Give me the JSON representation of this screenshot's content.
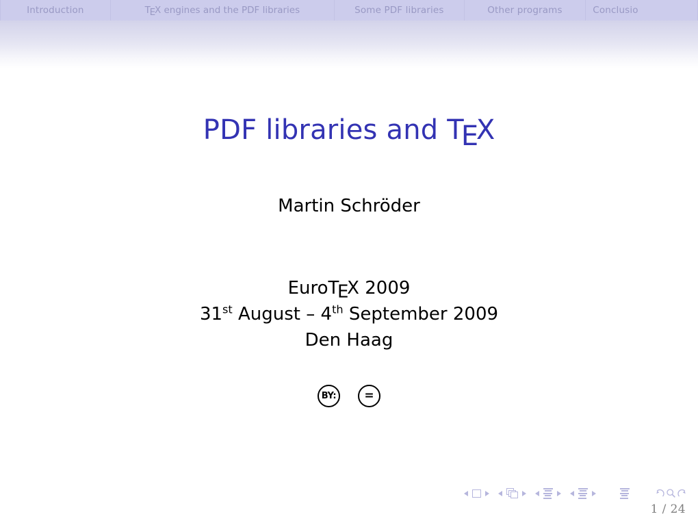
{
  "navbar": {
    "sections": [
      {
        "label": "Introduction",
        "id": "introduction"
      },
      {
        "label": "TEX engines and the PDF libraries",
        "id": "tex-engines-and-the-pdf-libraries",
        "prefix": "T",
        "mid": "E",
        "suffix": "X engines and the PDF libraries"
      },
      {
        "label": "Some PDF libraries",
        "id": "some-pdf-libraries"
      },
      {
        "label": "Other programs",
        "id": "other-programs"
      },
      {
        "label": "Conclusio",
        "id": "conclusion"
      }
    ],
    "background_color": "#ccccec",
    "text_color": "#9999c4"
  },
  "title": {
    "prefix": "PDF libraries and ",
    "tex_t": "T",
    "tex_e": "E",
    "tex_x": "X",
    "full_text": "PDF libraries and TEX",
    "color": "#3333b3"
  },
  "author": {
    "name": "Martin Schröder"
  },
  "event": {
    "conference_prefix": "Euro",
    "conference_tex_t": "T",
    "conference_tex_e": "E",
    "conference_tex_x": "X",
    "conference_year": " 2009",
    "conference_full": "EuroTEX 2009",
    "date_day_start": "31",
    "date_ord_start": "st",
    "date_month_start": " August ",
    "date_dash": "– ",
    "date_day_end": "4",
    "date_ord_end": "th",
    "date_month_end": " September 2009",
    "date_full": "31st August – 4th September 2009",
    "location": "Den Haag"
  },
  "license": {
    "badges": [
      {
        "id": "cc-by",
        "label": "BY:",
        "title": "Creative Commons Attribution"
      },
      {
        "id": "cc-nd",
        "label": "=",
        "title": "Creative Commons No Derivatives"
      }
    ]
  },
  "beamer_nav": {
    "icon_color": "#b6b6dd",
    "groups": [
      {
        "id": "slide",
        "prev": "◀",
        "icon": "slide-square-icon",
        "next": "▶"
      },
      {
        "id": "frame",
        "prev": "◀",
        "icon": "frames-stack-icon",
        "next": "▶"
      },
      {
        "id": "subsection",
        "prev": "◀",
        "icon": "subsection-lines-icon",
        "next": "▶"
      },
      {
        "id": "section",
        "prev": "◀",
        "icon": "section-lines-icon",
        "next": "▶"
      }
    ],
    "document_icon": "document-lines-icon",
    "back_icon": "back-arrow-icon",
    "search_icon": "search-icon",
    "forward_icon": "forward-arrow-icon"
  },
  "footer": {
    "page_current": "1",
    "page_separator": "/",
    "page_total": "24",
    "page_counter": "1 / 24",
    "color": "#808080"
  }
}
